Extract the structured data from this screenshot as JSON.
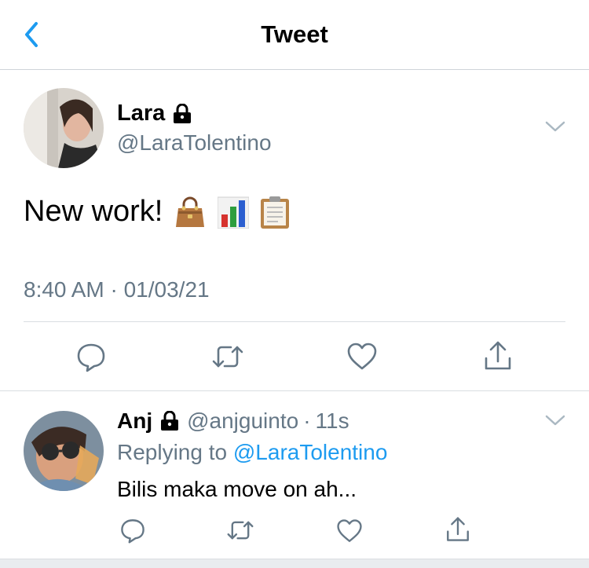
{
  "nav": {
    "title": "Tweet"
  },
  "tweet": {
    "name": "Lara",
    "handle": "@LaraTolentino",
    "text": "New work!",
    "emojis": [
      "handbag-emoji",
      "bar-chart-emoji",
      "clipboard-emoji"
    ],
    "timestamp": "8:40 AM · 01/03/21"
  },
  "reply": {
    "name": "Anj",
    "handle": "@anjguinto",
    "separator": "·",
    "time": "11s",
    "replying_prefix": "Replying to",
    "replying_to": "@LaraTolentino",
    "text": "Bilis maka move on ah..."
  },
  "colors": {
    "accent": "#1d9bf0",
    "secondary_text": "#657786",
    "icon": "#657786",
    "divider": "#d9dde1"
  }
}
